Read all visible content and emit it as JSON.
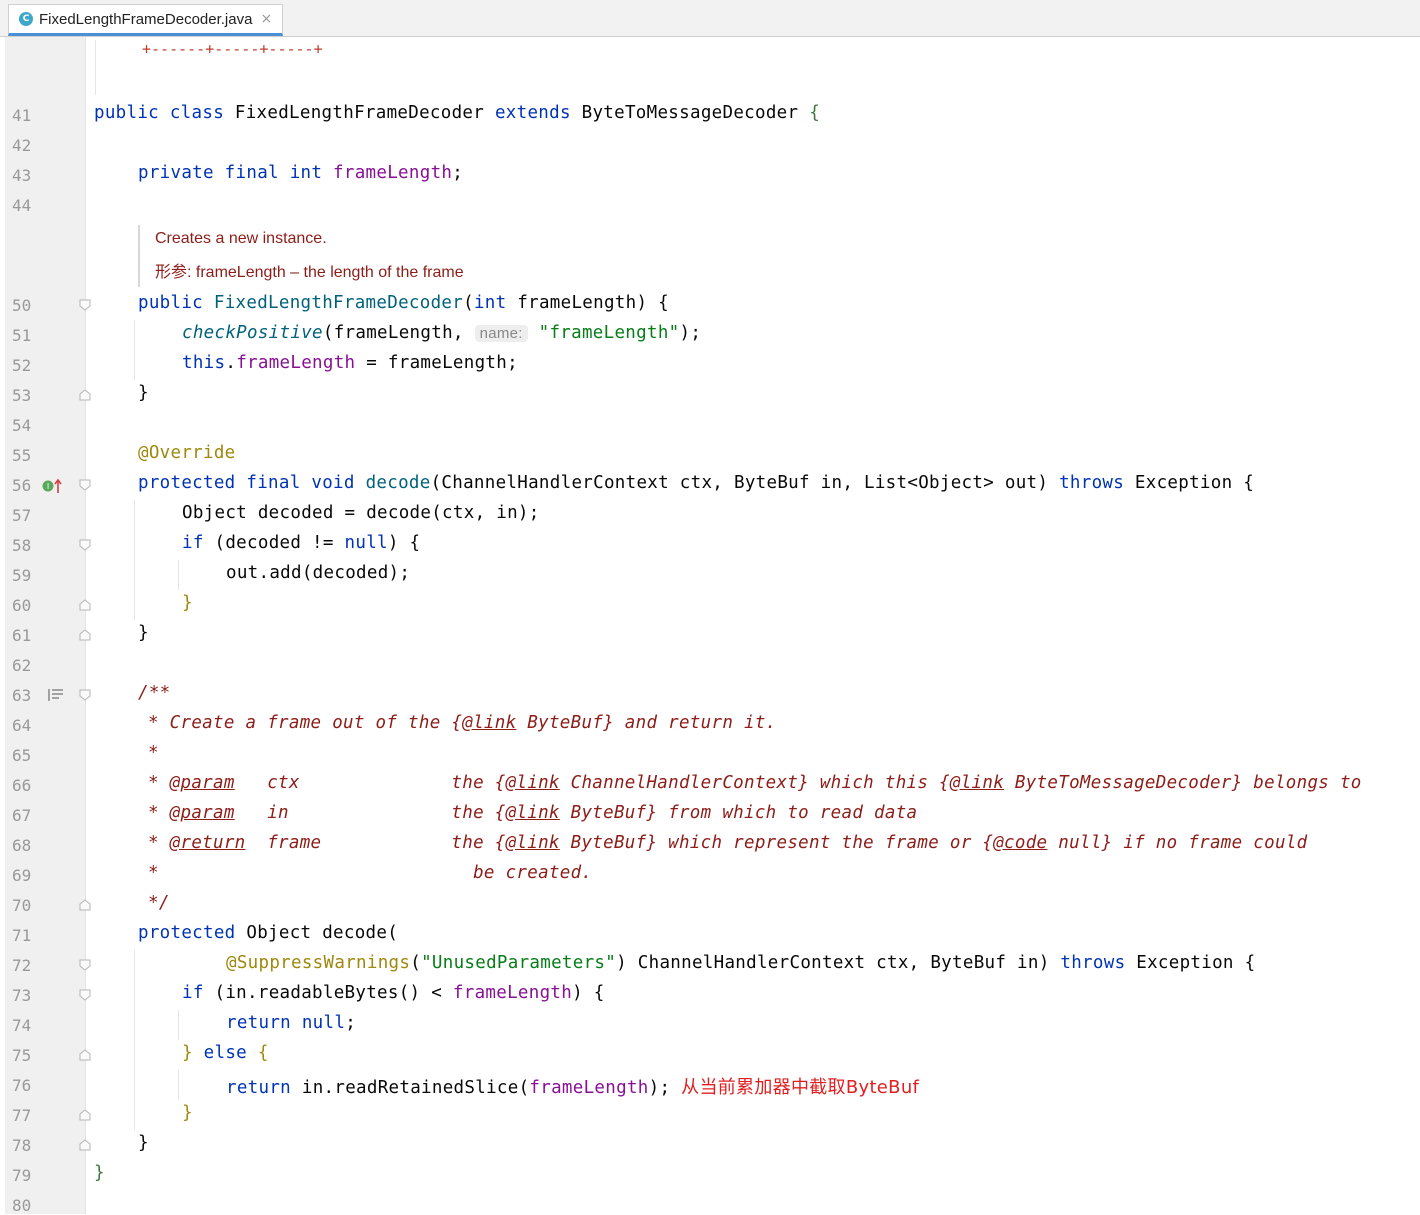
{
  "tab": {
    "icon_letter": "C",
    "title": "FixedLengthFrameDecoder.java",
    "close": "×"
  },
  "table_border": "+------+-----+-----+",
  "line_numbers": [
    "41",
    "42",
    "43",
    "44",
    "50",
    "51",
    "52",
    "53",
    "54",
    "55",
    "56",
    "57",
    "58",
    "59",
    "60",
    "61",
    "62",
    "63",
    "64",
    "65",
    "66",
    "67",
    "68",
    "69",
    "70",
    "71",
    "72",
    "73",
    "74",
    "75",
    "76",
    "77",
    "78",
    "79",
    "80"
  ],
  "doc_popup": {
    "line1": "Creates a new instance.",
    "line2": "形参: frameLength – the length of the frame"
  },
  "code": {
    "l41": [
      "public class ",
      "FixedLengthFrameDecoder ",
      "extends ",
      "ByteToMessageDecoder ",
      "{"
    ],
    "l43": [
      "private final int ",
      "frameLength",
      ";"
    ],
    "l50": [
      "public ",
      "FixedLengthFrameDecoder",
      "(",
      "int ",
      "frameLength) {"
    ],
    "l51": [
      "checkPositive",
      "(frameLength, ",
      "name:",
      " ",
      "\"frameLength\"",
      ");"
    ],
    "l52": [
      "this",
      ".",
      "frameLength",
      " = frameLength;"
    ],
    "l53": "}",
    "l55": "@Override",
    "l56": [
      "protected final void ",
      "decode",
      "(ChannelHandlerContext ctx, ByteBuf in, List<Object> out) ",
      "throws ",
      "Exception {"
    ],
    "l57": "Object decoded = decode(ctx, in);",
    "l58": [
      "if ",
      "(decoded != ",
      "null",
      ") {"
    ],
    "l59": "out.add(decoded);",
    "l60": "}",
    "l61": "}",
    "l63": "/**",
    "l64": [
      "* Create a frame out of the {",
      "@link",
      " ByteBuf} and return it."
    ],
    "l65": "*",
    "l66": [
      "* ",
      "@param",
      "   ctx              the {",
      "@link",
      " ChannelHandlerContext} which this {",
      "@link",
      " ByteToMessageDecoder} belongs to"
    ],
    "l67": [
      "* ",
      "@param",
      "   in               the {",
      "@link",
      " ByteBuf} from which to read data"
    ],
    "l68": [
      "* ",
      "@return",
      "  frame            the {",
      "@link",
      " ByteBuf} which represent the frame or {",
      "@code",
      " null} if no frame could"
    ],
    "l69": "*                             be created.",
    "l70": "*/",
    "l71": [
      "protected ",
      "Object decode("
    ],
    "l72": [
      "@SuppressWarnings",
      "(",
      "\"UnusedParameters\"",
      ") ChannelHandlerContext ctx, ByteBuf in) ",
      "throws ",
      "Exception {"
    ],
    "l73": [
      "if ",
      "(in.readableBytes() < ",
      "frameLength",
      ") {"
    ],
    "l74": [
      "return null",
      ";"
    ],
    "l75": [
      "} ",
      "else ",
      "{"
    ],
    "l76": [
      "return ",
      "in.readRetainedSlice(",
      "frameLength",
      "); "
    ],
    "l76_note": "从当前累加器中截取ByteBuf",
    "l77": "}",
    "l78": "}",
    "l79": "}"
  },
  "gutter_icons": {
    "override": "override-icon",
    "doc": "rendered-doc-icon"
  }
}
